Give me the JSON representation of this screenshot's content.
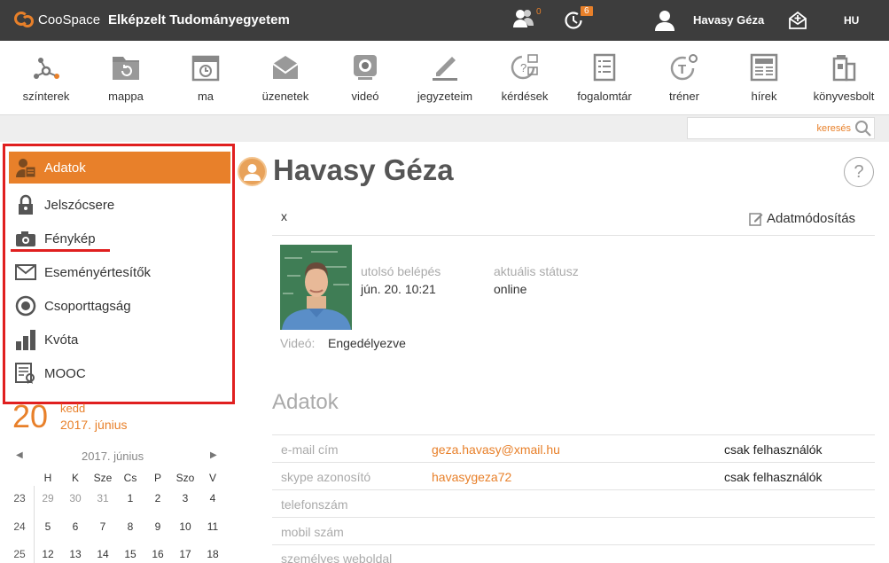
{
  "topbar": {
    "logo_text": "CooSpace",
    "university": "Elképzelt Tudományegyetem",
    "contacts_badge": "0",
    "history_badge": "6",
    "username": "Havasy Géza",
    "language": "HU"
  },
  "toolbar": [
    {
      "label": "színterek",
      "icon": "network-icon"
    },
    {
      "label": "mappa",
      "icon": "folder-icon"
    },
    {
      "label": "ma",
      "icon": "calendar-clock-icon"
    },
    {
      "label": "üzenetek",
      "icon": "envelope-icon"
    },
    {
      "label": "videó",
      "icon": "webcam-icon"
    },
    {
      "label": "jegyzeteim",
      "icon": "pencil-icon"
    },
    {
      "label": "kérdések",
      "icon": "questions-icon"
    },
    {
      "label": "fogalomtár",
      "icon": "glossary-icon"
    },
    {
      "label": "tréner",
      "icon": "trainer-icon"
    },
    {
      "label": "hírek",
      "icon": "newspaper-icon"
    },
    {
      "label": "könyvesbolt",
      "icon": "bookshop-icon"
    }
  ],
  "search": {
    "placeholder": "keresés"
  },
  "sidebar": {
    "items": [
      {
        "label": "Adatok",
        "icon": "id-card-icon",
        "active": true
      },
      {
        "label": "Jelszócsere",
        "icon": "lock-icon"
      },
      {
        "label": "Fénykép",
        "icon": "camera-icon"
      },
      {
        "label": "Eseményértesítők",
        "icon": "envelope-icon"
      },
      {
        "label": "Csoporttagság",
        "icon": "target-icon"
      },
      {
        "label": "Kvóta",
        "icon": "bar-chart-icon"
      },
      {
        "label": "MOOC",
        "icon": "certificate-icon"
      }
    ]
  },
  "calendar": {
    "day_number": "20",
    "day_name": "kedd",
    "full_date": "2017. június",
    "month_label": "2017. június",
    "weekday_headers": [
      "H",
      "K",
      "Sze",
      "Cs",
      "P",
      "Szo",
      "V"
    ],
    "weeks": [
      {
        "week": "23",
        "days": [
          "29",
          "30",
          "31",
          "1",
          "2",
          "3",
          "4"
        ]
      },
      {
        "week": "24",
        "days": [
          "5",
          "6",
          "7",
          "8",
          "9",
          "10",
          "11"
        ]
      },
      {
        "week": "25",
        "days": [
          "12",
          "13",
          "14",
          "15",
          "16",
          "17",
          "18"
        ]
      }
    ]
  },
  "profile": {
    "name": "Havasy Géza",
    "x_label": "x",
    "edit_label": "Adatmódosítás",
    "last_login_label": "utolsó belépés",
    "last_login_value": "jún. 20. 10:21",
    "status_label": "aktuális státusz",
    "status_value": "online",
    "video_label": "Videó:",
    "video_value": "Engedélyezve",
    "section_title": "Adatok",
    "rows": [
      {
        "label": "e-mail cím",
        "value": "geza.havasy@xmail.hu",
        "visibility": "csak felhasználók"
      },
      {
        "label": "skype azonosító",
        "value": "havasygeza72",
        "visibility": "csak felhasználók"
      },
      {
        "label": "telefonszám",
        "value": "",
        "visibility": ""
      },
      {
        "label": "mobil szám",
        "value": "",
        "visibility": ""
      },
      {
        "label": "személyes weboldal",
        "value": "",
        "visibility": ""
      }
    ]
  },
  "colors": {
    "accent": "#e8802a",
    "topbar": "#3d3d3d",
    "highlight_border": "#e01f1f"
  }
}
